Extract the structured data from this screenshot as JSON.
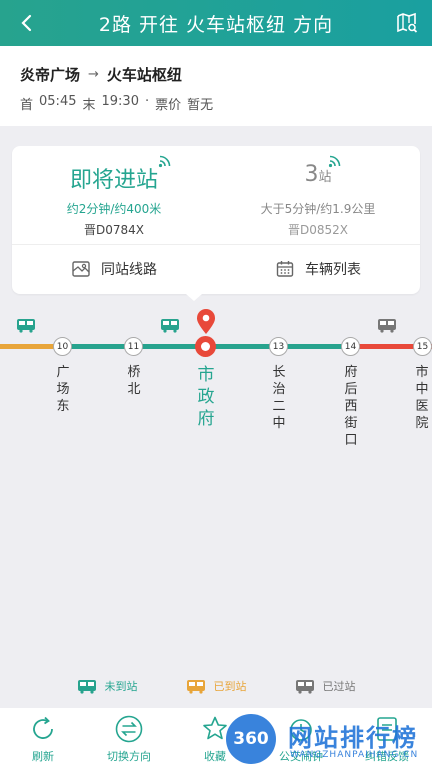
{
  "header": {
    "title": "2路 开往 火车站枢纽 方向"
  },
  "route_info": {
    "from": "炎帝广场",
    "to": "火车站枢纽",
    "first_label": "首",
    "first_time": "05:45",
    "last_label": "末",
    "last_time": "19:30",
    "separator": "·",
    "fare_label": "票价",
    "fare_value": "暂无"
  },
  "card": {
    "bus1": {
      "status": "即将进站",
      "eta": "约2分钟/约400米",
      "plate": "晋D0784X"
    },
    "bus2": {
      "stops_count": "3",
      "stops_unit": "站",
      "eta": "大于5分钟/约1.9公里",
      "plate": "晋D0852X"
    },
    "actions": {
      "same_station": "同站线路",
      "vehicle_list": "车辆列表"
    }
  },
  "stations": {
    "s10": {
      "num": "10",
      "name": "广场东"
    },
    "s11": {
      "num": "11",
      "name": "桥北"
    },
    "current": {
      "name": "市政府"
    },
    "s13": {
      "num": "13",
      "name": "长治二中"
    },
    "s14": {
      "num": "14",
      "name": "府后西街口"
    },
    "s15": {
      "num": "15",
      "name": "市中医院"
    }
  },
  "legend": {
    "not_arrived": "未到站",
    "arrived": "已到站",
    "passed": "已过站"
  },
  "bottom_nav": {
    "refresh": "刷新",
    "switch": "切换方向",
    "favorite": "收藏",
    "reminder": "公交闹钟",
    "error": "纠错反馈"
  },
  "watermark": {
    "logo": "360",
    "name": "网站排行榜",
    "sub": "WANGZHANPAIHANG.CN"
  },
  "colors": {
    "accent": "#25a590",
    "orange": "#e8a53a",
    "red": "#e8493a",
    "grey": "#777777"
  }
}
